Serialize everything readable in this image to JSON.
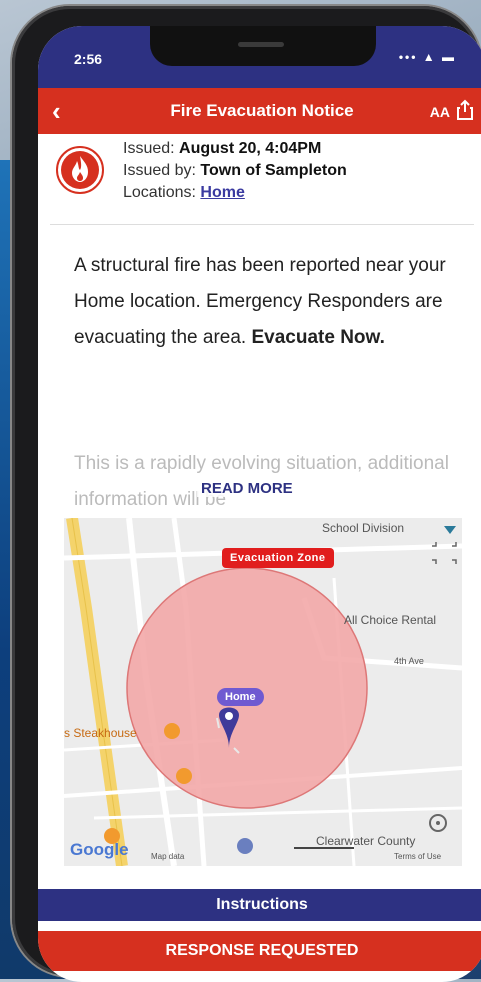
{
  "status": {
    "time": "2:56",
    "icons": "••• ▲ ▬"
  },
  "nav": {
    "back_icon": "‹",
    "title": "Fire Evacuation Notice",
    "font_size_label": "AA"
  },
  "notice": {
    "issued_label": "Issued:",
    "issued_value": "August 20, 4:04PM",
    "issued_by_label": "Issued by:",
    "issued_by_value": "Town of Sampleton",
    "locations_label": "Locations:",
    "locations_value": "Home",
    "body": "A structural fire has been reported near your Home location. Emergency Responders are evacuating the area.",
    "body_emphasis": "Evacuate Now.",
    "more_text": "This is a rapidly evolving situation, additional information will be",
    "read_more": "READ MORE"
  },
  "map": {
    "zone_label": "Evacuation Zone",
    "home_label": "Home",
    "labels": {
      "school": "School Division",
      "rental": "All Choice Rental",
      "steakhouse": "s Steakhouse",
      "county": "Clearwater County",
      "ave": "4th Ave",
      "google": "Google",
      "mapdata": "Map data",
      "terms": "Terms of Use"
    },
    "colors": {
      "zone_fill": "#f3a9a9",
      "zone_stroke": "#d77"
    }
  },
  "bottom": {
    "instructions": "Instructions",
    "response": "RESPONSE REQUESTED"
  },
  "colors": {
    "navy": "#2d3182",
    "red": "#d6301f"
  }
}
